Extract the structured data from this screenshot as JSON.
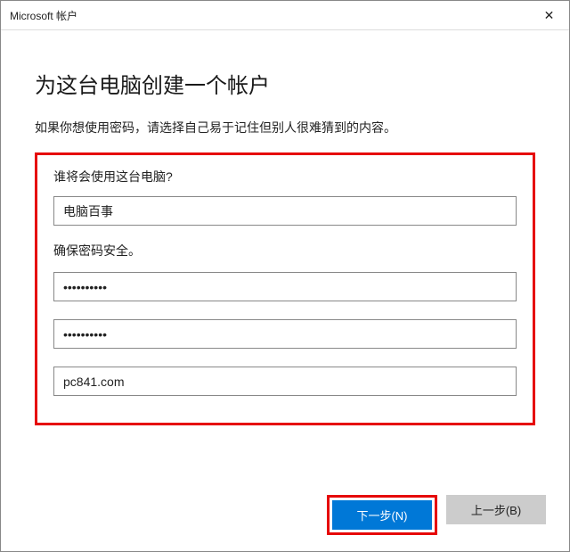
{
  "titlebar": {
    "title": "Microsoft 帐户",
    "close_glyph": "✕"
  },
  "heading": "为这台电脑创建一个帐户",
  "subtext": "如果你想使用密码，请选择自己易于记住但别人很难猜到的内容。",
  "labels": {
    "who_uses": "谁将会使用这台电脑?",
    "secure_pwd": "确保密码安全。"
  },
  "fields": {
    "username": "电脑百事",
    "password1": "••••••••••",
    "password2": "••••••••••",
    "hint": "pc841.com"
  },
  "buttons": {
    "next": "下一步(N)",
    "back": "上一步(B)"
  }
}
